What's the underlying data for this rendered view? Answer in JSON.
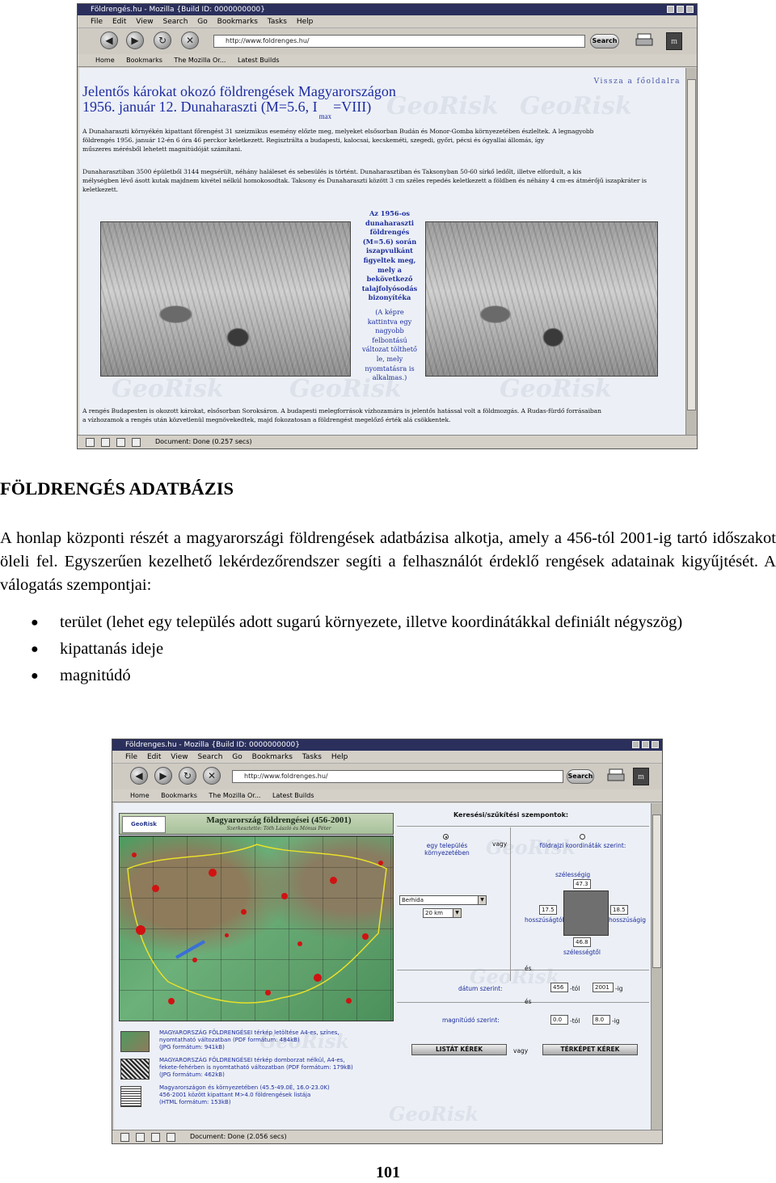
{
  "screenshot1": {
    "window_title": "Földrengés.hu - Mozilla {Build ID: 0000000000}",
    "menu": [
      "File",
      "Edit",
      "View",
      "Search",
      "Go",
      "Bookmarks",
      "Tasks",
      "Help"
    ],
    "url": "http://www.foldrenges.hu/",
    "search_label": "Search",
    "bookmarks": [
      "Home",
      "Bookmarks",
      "The Mozilla Or...",
      "Latest Builds"
    ],
    "back_link": "Vissza a főoldalra",
    "title_line1": "Jelentős károkat okozó földrengések Magyarországon",
    "title_line2": "1956. január 12. Dunaharaszti (M=5.6, I",
    "title_sub": "max",
    "title_tail": "=VIII)",
    "para1": [
      "A Dunaharaszti környékén kipattant főrengést 31 szeizmikus esemény előzte meg, melyeket elsősorban Budán és Monor-Gomba környezetében észleltek. A legnagyobb",
      "földrengés 1956. január 12-én 6 óra 46 perckor keletkezett. Regisztrálta a budapesti, kalocsai, kecskeméti, szegedi, győri, pécsi és ógyallai állomás, így",
      "műszeres mérésből lehetett magnitúdóját számítani."
    ],
    "para2": [
      "Dunaharasztiban 3500 épületből 3144 megsérült, néhány haláleset és sebesülés is történt. Dunaharasztiban és Taksonyban 50-60 sírkő ledőlt, illetve elfordult, a kis",
      "mélységben lévő ásott kutak majdnem kivétel nélkül homokosodtak. Taksony és Dunaharaszti között 3 cm széles repedés keletkezett a földben és néhány 4 cm-es átmérőjű iszapkráter is",
      "keletkezett."
    ],
    "caption": [
      "Az 1956-os",
      "dunaharaszti",
      "földrengés",
      "(M=5.6) során",
      "iszapvulkánt",
      "figyeltek meg,",
      "mely a",
      "bekövetkező",
      "talajfolyósodás",
      "bizonyítéka",
      "",
      "(A képre",
      "kattintva egy",
      "nagyobb",
      "felbontású",
      "változat tölthető",
      "le, mely",
      "nyomtatásra is",
      "alkalmas.)"
    ],
    "para3": [
      "A rengés Budapesten is okozott károkat, elsősorban Soroksáron. A budapesti melegforrások vízhozamára is jelentős hatással volt a földmozgás. A Rudas-fürdő forrásaiban",
      "a vízhozamok a rengés után közvetlenül megnövekedtek, majd fokozatosan a földrengést megelőző érték alá csökkentek."
    ],
    "status": "Document: Done (0.257 secs)"
  },
  "document": {
    "heading": "FÖLDRENGÉS ADATBÁZIS",
    "paragraph": "A honlap központi részét a magyarországi földrengések adatbázisa alkotja, amely a 456-tól 2001-ig tartó időszakot öleli fel. Egyszerűen kezelhető lekérdezőrendszer segíti a felhasználót érdeklő rengések adatainak kigyűjtését. A válogatás szempontjai:",
    "bullets": [
      "terület (lehet egy település adott sugarú környezete, illetve koordinátákkal definiált négyszög)",
      "kipattanás ideje",
      "magnitúdó"
    ],
    "page_number": "101"
  },
  "screenshot2": {
    "window_title": "Földrenges.hu - Mozilla {Build ID: 0000000000}",
    "menu": [
      "File",
      "Edit",
      "View",
      "Search",
      "Go",
      "Bookmarks",
      "Tasks",
      "Help"
    ],
    "url": "http://www.foldrenges.hu/",
    "search_label": "Search",
    "bookmarks": [
      "Home",
      "Bookmarks",
      "The Mozilla Or...",
      "Latest Builds"
    ],
    "map_title": "Magyarország földrengései (456-2001)",
    "map_subtitle": "Szerkesztette: Tóth László és Mónus Péter",
    "logo": "GeoRisk",
    "panel_title": "Keresési/szűkítési szempontok:",
    "option_settlement": "egy település környezetében",
    "or_label": "vagy",
    "option_coords": "földrajzi koordináták szerint:",
    "settlement_value": "Berhida",
    "radius_value": "20 km",
    "lat_label": "szélességig",
    "lat_max": "47.3",
    "lon_min": "17.5",
    "lon_min_label": "hosszúságtól",
    "lon_max": "18.5",
    "lon_max_label": "hosszúságig",
    "lat_min": "46.8",
    "lat_min_label": "szélességtől",
    "and_label": "és",
    "date_label": "dátum szerint:",
    "date_from": "456",
    "from_suffix": "-tól",
    "date_to": "2001",
    "to_suffix": "-ig",
    "mag_label": "magnitúdó szerint:",
    "mag_from": "0.0",
    "mag_to": "8.0",
    "mag_to_suffix": "-ig",
    "list_button": "LISTÁT KÉREK",
    "map_button": "TÉRKÉPET KÉREK",
    "link1": [
      "MAGYARORSZÁG FÖLDRENGÉSEI térkép letöltése A4-es, színes,",
      "nyomtatható változatban (PDF formátum: 484kB)",
      "(JPG formátum: 941kB)"
    ],
    "link2": [
      "MAGYARORSZÁG FÖLDRENGÉSEI térkép domborzat nélkül, A4-es,",
      "fekete-fehérben is nyomtatható változatban (PDF formátum: 179kB)",
      "(JPG formátum: 462kB)"
    ],
    "link3": [
      "Magyarországon és környezetében (45.5-49.0É, 16.0-23.0K)",
      "456-2001 között kipattant M>4.0 földrengések listája",
      "(HTML formátum: 153kB)"
    ],
    "status": "Document: Done (2.056 secs)"
  },
  "colors": {
    "link_blue": "#1d2ba0",
    "map_dot": "#d01212",
    "titlebar": "#2a2f5c"
  }
}
